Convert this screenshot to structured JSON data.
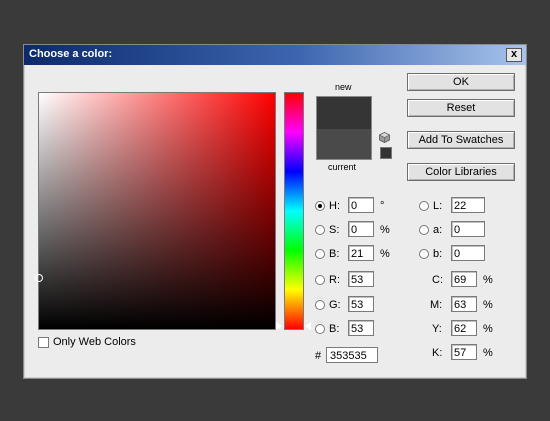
{
  "dialog": {
    "title": "Choose a color:",
    "close_glyph": "x"
  },
  "preview": {
    "new_label": "new",
    "current_label": "current",
    "new_color": "#353535",
    "current_color": "#4a4a4a"
  },
  "buttons": {
    "ok": "OK",
    "reset": "Reset",
    "add_to_swatches": "Add To Swatches",
    "color_libraries": "Color Libraries"
  },
  "hsb": {
    "h_label": "H:",
    "h_value": "0",
    "h_unit": "°",
    "s_label": "S:",
    "s_value": "0",
    "s_unit": "%",
    "b_label": "B:",
    "b_value": "21",
    "b_unit": "%"
  },
  "rgb": {
    "r_label": "R:",
    "r_value": "53",
    "g_label": "G:",
    "g_value": "53",
    "b_label": "B:",
    "b_value": "53"
  },
  "lab": {
    "l_label": "L:",
    "l_value": "22",
    "a_label": "a:",
    "a_value": "0",
    "b_label": "b:",
    "b_value": "0"
  },
  "cmyk": {
    "c_label": "C:",
    "c_value": "69",
    "c_unit": "%",
    "m_label": "M:",
    "m_value": "63",
    "m_unit": "%",
    "y_label": "Y:",
    "y_value": "62",
    "y_unit": "%",
    "k_label": "K:",
    "k_value": "57",
    "k_unit": "%"
  },
  "hex": {
    "label": "#",
    "value": "353535"
  },
  "web_colors": {
    "label": "Only Web Colors",
    "checked": false
  },
  "selected_mode": "H"
}
